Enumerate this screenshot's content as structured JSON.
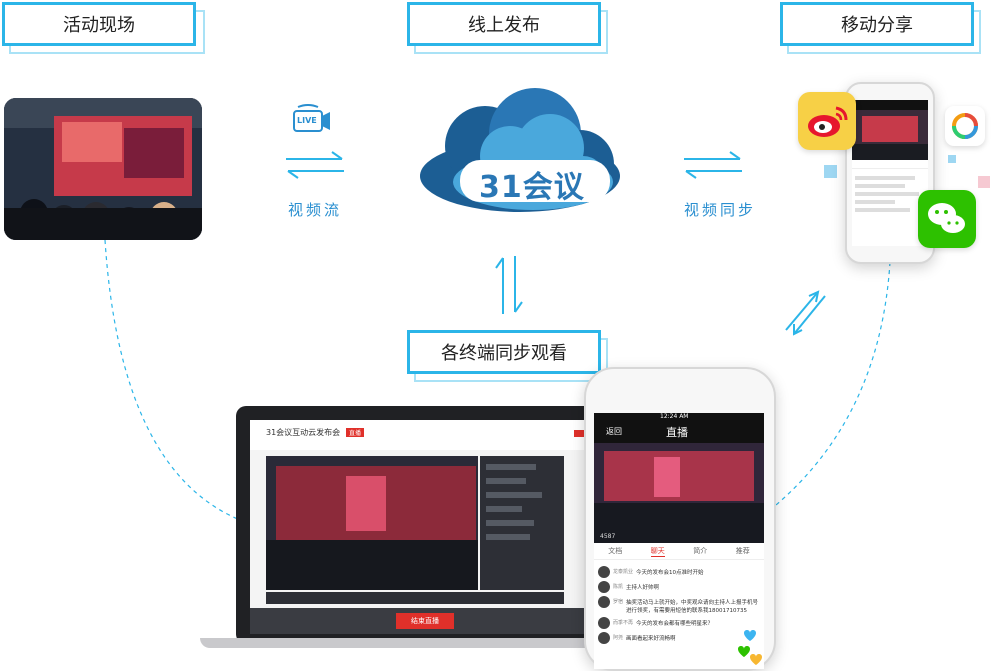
{
  "labels": {
    "event_site": "活动现场",
    "online_publish": "线上发布",
    "mobile_share": "移动分享",
    "multi_terminal": "各终端同步观看"
  },
  "captions": {
    "video_stream": "视频流",
    "video_sync": "视频同步"
  },
  "cloud_logo": "31会议",
  "live_icon_text": "LIVE",
  "laptop_screen": {
    "title": "31会议互动云发布会",
    "badge": "直播",
    "end_live_button": "结束直播"
  },
  "phone_screen": {
    "time": "12:24 AM",
    "back": "返回",
    "title": "直播",
    "viewers": "4587",
    "tabs": [
      "文档",
      "聊天",
      "简介",
      "推荐"
    ],
    "chat": [
      {
        "user": "龙泰凯业",
        "text": "今天的发布会10点准时开始"
      },
      {
        "user": "陈凯",
        "text": "主持人好帅啊"
      },
      {
        "user": "罗宿",
        "text": "抽奖活动马上就开始，中奖观众请向主持人上报手机号进行领奖，有需要用短信的联系我18001710735"
      },
      {
        "user": "而季不再",
        "text": "今天的发布会都有哪些明星来？"
      },
      {
        "user": "阿尧",
        "text": "画面看起来好流畅啊"
      }
    ]
  },
  "colors": {
    "accent": "#2bb5e8",
    "cloud_dark": "#1c5e94",
    "cloud_light": "#4aa8dc",
    "live_red": "#e0302a",
    "weibo_red": "#e6162d",
    "wechat_green": "#2dc100"
  }
}
